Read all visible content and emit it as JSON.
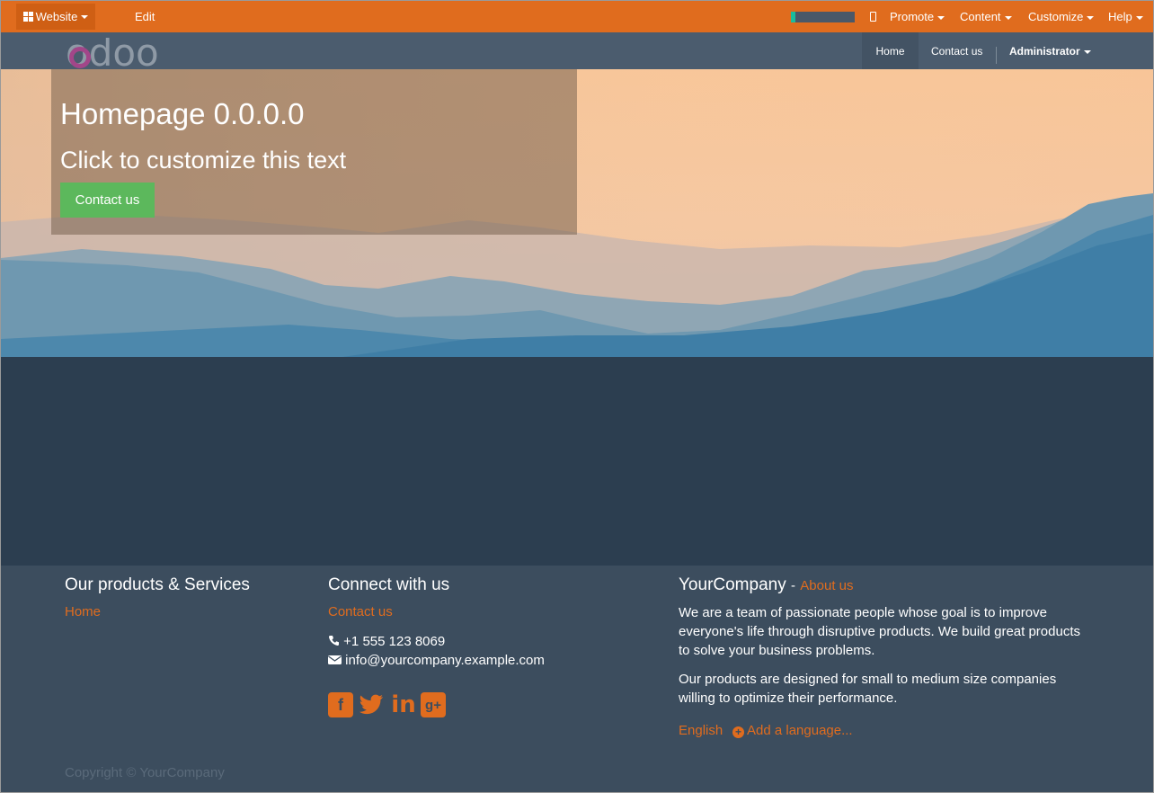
{
  "adminbar": {
    "website_label": "Website",
    "edit_label": "Edit",
    "progress": 0.07,
    "menu": [
      "Promote",
      "Content",
      "Customize",
      "Help"
    ]
  },
  "navbar": {
    "logo_text": "odoo",
    "items": [
      "Home",
      "Contact us"
    ],
    "user": "Administrator"
  },
  "hero": {
    "title": "Homepage 0.0.0.0",
    "subtitle": "Click to customize this text",
    "button": "Contact us"
  },
  "footer": {
    "col1": {
      "title": "Our products & Services",
      "link": "Home"
    },
    "col2": {
      "title": "Connect with us",
      "link": "Contact us",
      "phone": "+1 555 123 8069",
      "email": "info@yourcompany.example.com",
      "social": [
        "facebook",
        "twitter",
        "linkedin",
        "google-plus"
      ]
    },
    "col3": {
      "company": "YourCompany",
      "separator": "-",
      "about_link": "About us",
      "para1": "We are a team of passionate people whose goal is to improve everyone's life through disruptive products. We build great products to solve your business problems.",
      "para2": "Our products are designed for small to medium size companies willing to optimize their performance.",
      "language": "English",
      "add_language": "Add a language..."
    },
    "copyright": "Copyright © YourCompany"
  },
  "colors": {
    "accent": "#e06c1e",
    "navbar": "#4b5c6e",
    "footer": "#3c4d5e",
    "dark": "#2c3e50",
    "button": "#5cb85c"
  }
}
